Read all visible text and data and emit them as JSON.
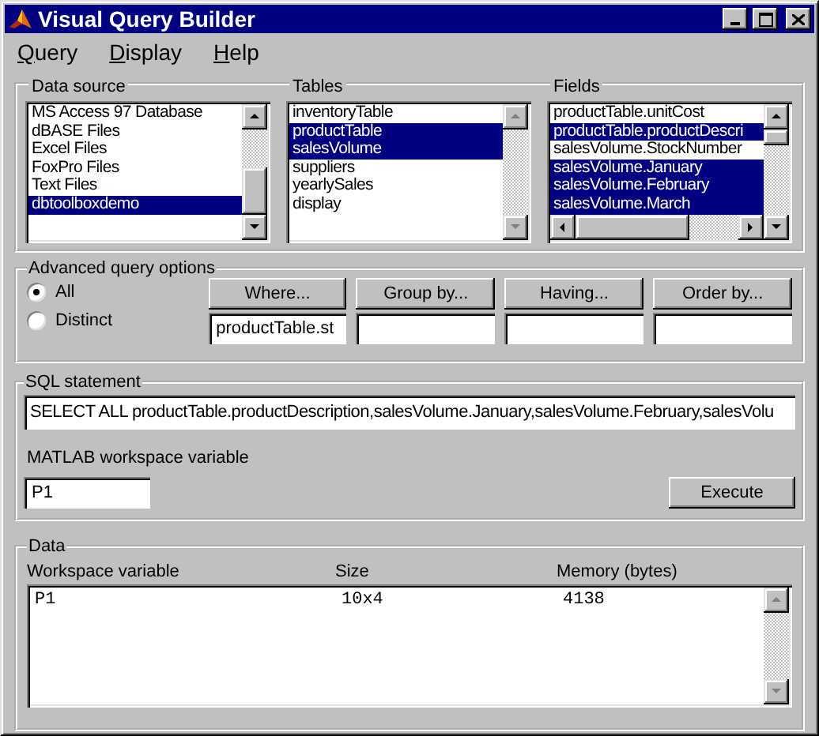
{
  "window": {
    "title": "Visual Query Builder"
  },
  "menu": [
    {
      "label": "Query"
    },
    {
      "label": "Display"
    },
    {
      "label": "Help"
    }
  ],
  "data_source": {
    "title": "Data source",
    "scrollbar_disabled": false,
    "items": [
      {
        "label": "MS Access 97 Database",
        "selected": false
      },
      {
        "label": "dBASE Files",
        "selected": false
      },
      {
        "label": "Excel Files",
        "selected": false
      },
      {
        "label": "FoxPro Files",
        "selected": false
      },
      {
        "label": "Text Files",
        "selected": false
      },
      {
        "label": "dbtoolboxdemo",
        "selected": true
      }
    ]
  },
  "tables": {
    "title": "Tables",
    "scrollbar_disabled": true,
    "items": [
      {
        "label": "inventoryTable",
        "selected": false
      },
      {
        "label": "productTable",
        "selected": true
      },
      {
        "label": "salesVolume",
        "selected": true
      },
      {
        "label": "suppliers",
        "selected": false
      },
      {
        "label": "yearlySales",
        "selected": false
      },
      {
        "label": "display",
        "selected": false
      }
    ]
  },
  "fields": {
    "title": "Fields",
    "scrollbar_disabled": false,
    "items": [
      {
        "label": "productTable.unitCost",
        "selected": false
      },
      {
        "label": "productTable.productDescri",
        "selected": true
      },
      {
        "label": "salesVolume.StockNumber",
        "selected": false
      },
      {
        "label": "salesVolume.January",
        "selected": true
      },
      {
        "label": "salesVolume.February",
        "selected": true
      },
      {
        "label": "salesVolume.March",
        "selected": true
      }
    ]
  },
  "advanced": {
    "title": "Advanced query options",
    "options": [
      {
        "label": "All",
        "selected": true
      },
      {
        "label": "Distinct",
        "selected": false
      }
    ],
    "clauses": [
      {
        "button": "Where...",
        "value": "productTable.st"
      },
      {
        "button": "Group by..."
      },
      {
        "button": "Having..."
      },
      {
        "button": "Order by..."
      }
    ]
  },
  "sql": {
    "title": "SQL statement",
    "statement": "SELECT ALL productTable.productDescription,salesVolume.January,salesVolume.February,salesVolu",
    "variable_label": "MATLAB workspace variable",
    "variable": "P1",
    "execute": "Execute"
  },
  "data": {
    "title": "Data",
    "scrollbar_disabled": true,
    "columns": [
      "Workspace variable",
      "Size",
      "Memory (bytes)"
    ],
    "rows": [
      [
        "P1",
        "10x4",
        "4138"
      ]
    ]
  }
}
